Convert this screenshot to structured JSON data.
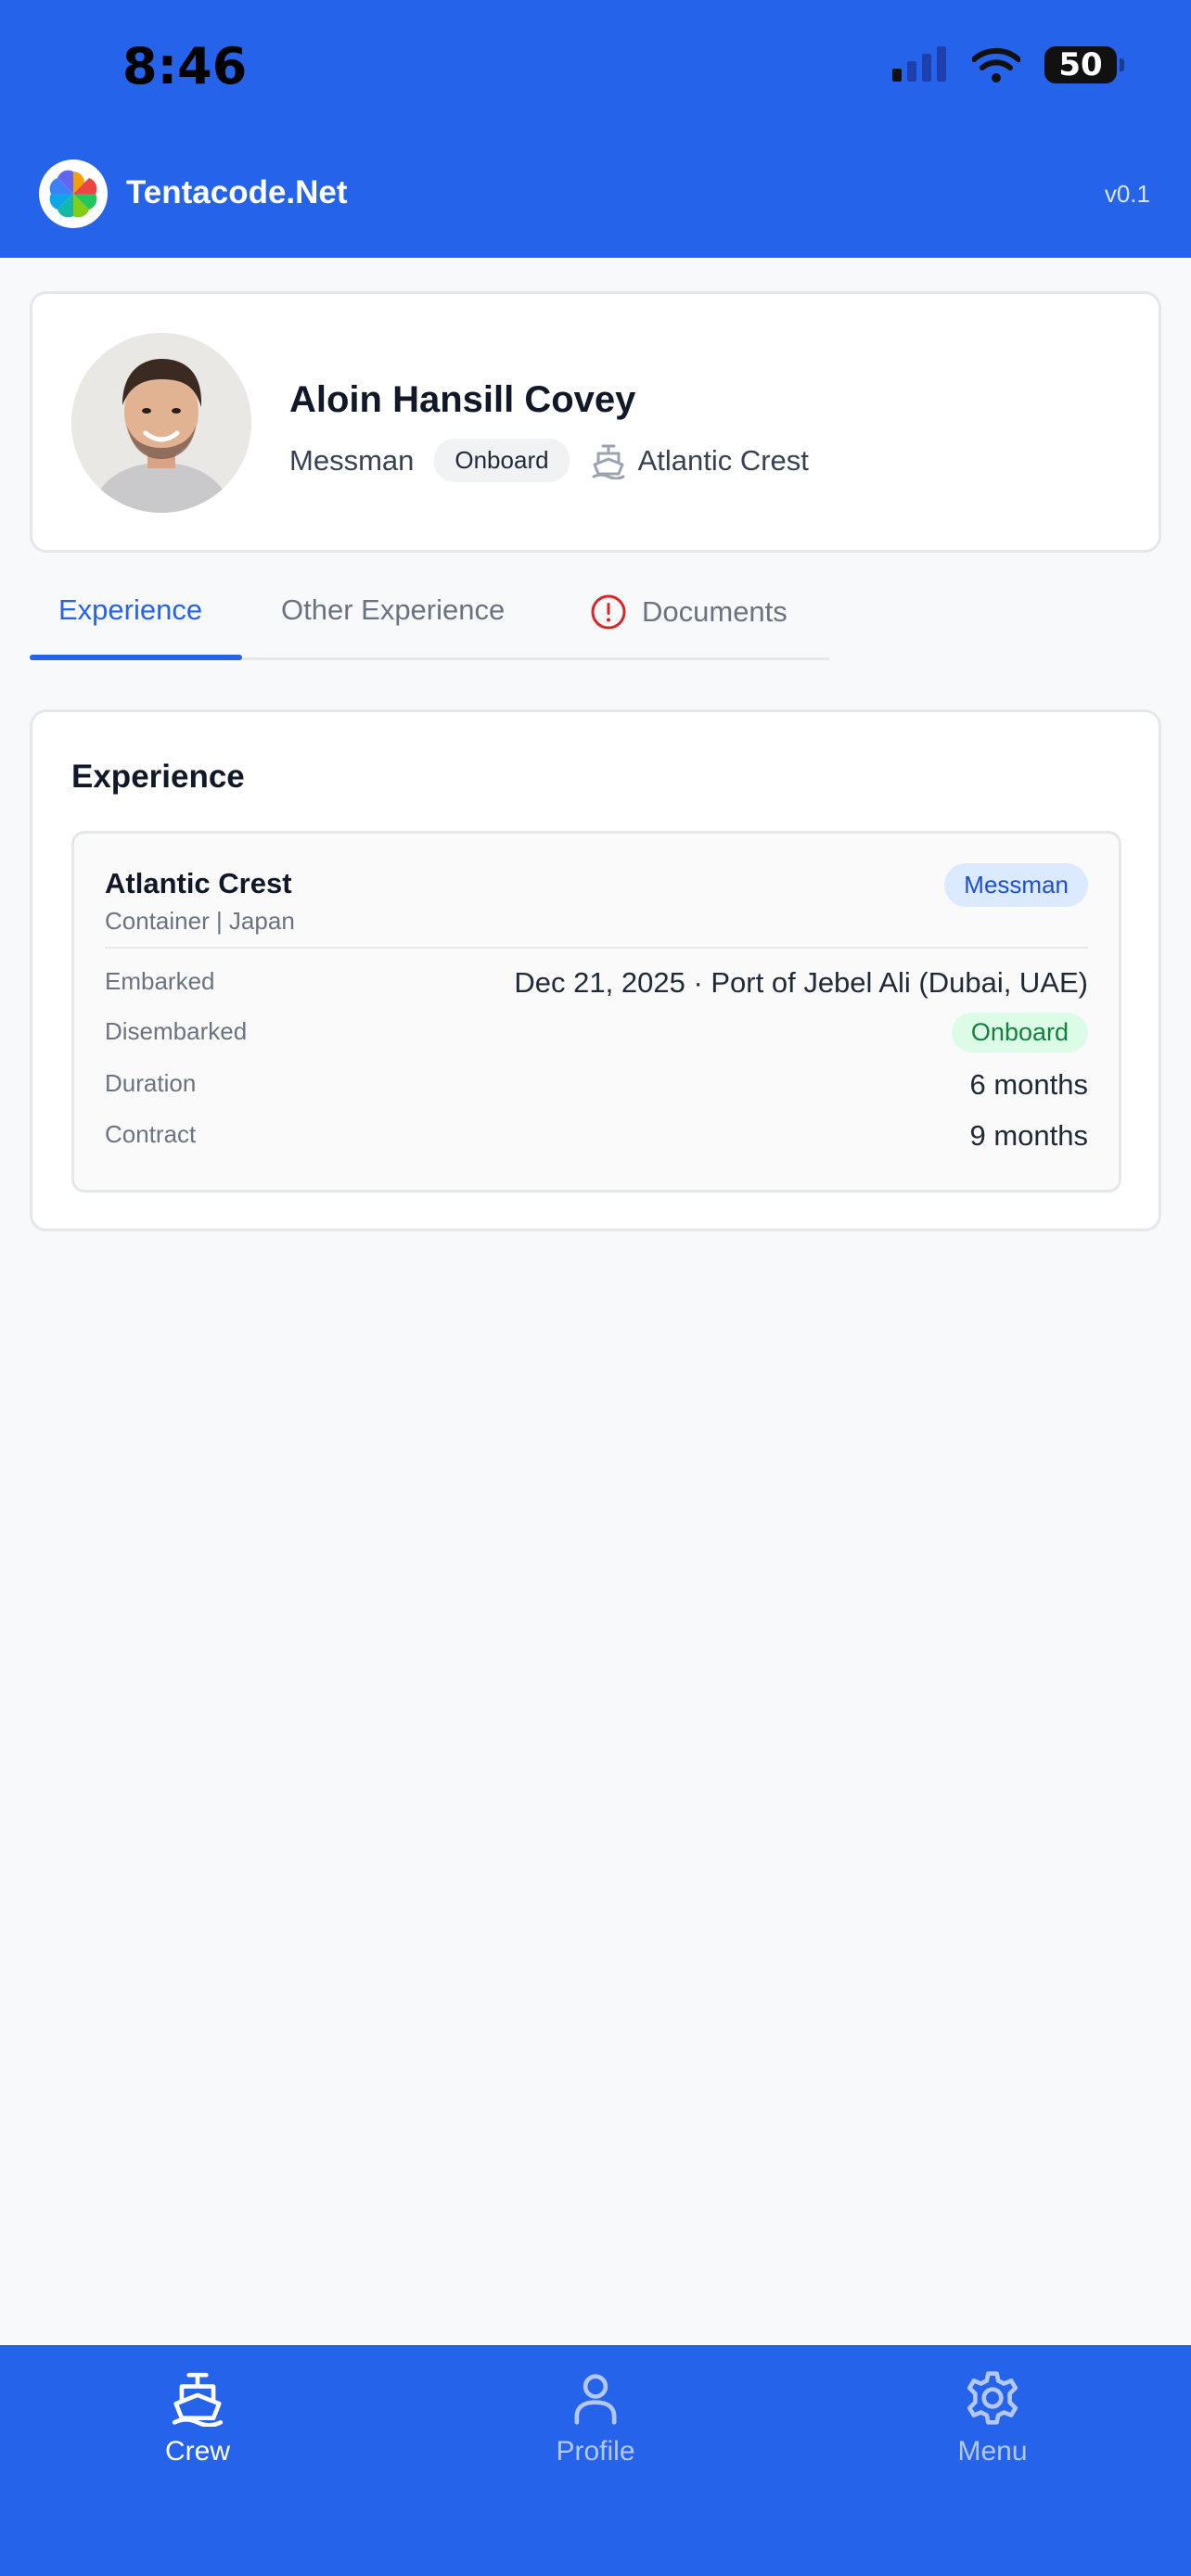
{
  "status_bar": {
    "time": "8:46",
    "battery": "50",
    "icons": [
      "cellular-signal-icon",
      "wifi-icon",
      "battery-icon"
    ]
  },
  "header": {
    "app_title": "Tentacode.Net",
    "version": "v0.1"
  },
  "profile": {
    "name": "Aloin Hansill Covey",
    "rank": "Messman",
    "status": "Onboard",
    "vessel": "Atlantic Crest"
  },
  "tabs": [
    {
      "label": "Experience",
      "active": true
    },
    {
      "label": "Other Experience",
      "active": false
    },
    {
      "label": "Documents",
      "active": false,
      "alert": true
    }
  ],
  "experience": {
    "heading": "Experience",
    "entries": [
      {
        "vessel": "Atlantic Crest",
        "subtitle": "Container | Japan",
        "rank": "Messman",
        "rows": [
          {
            "label": "Embarked",
            "value": "Dec 21, 2025 · Port of Jebel Ali (Dubai, UAE)"
          },
          {
            "label": "Disembarked",
            "value": "Onboard"
          },
          {
            "label": "Duration",
            "value": "6 months"
          },
          {
            "label": "Contract",
            "value": "9 months"
          }
        ]
      }
    ]
  },
  "bottom_nav": [
    {
      "label": "Crew",
      "icon": "ship-icon",
      "active": true
    },
    {
      "label": "Profile",
      "icon": "user-icon",
      "active": false
    },
    {
      "label": "Menu",
      "icon": "gear-icon",
      "active": false
    }
  ],
  "colors": {
    "primary": "#2563eb",
    "background": "#f8f9fb",
    "success": "#15803d",
    "alert": "#dc2626"
  }
}
